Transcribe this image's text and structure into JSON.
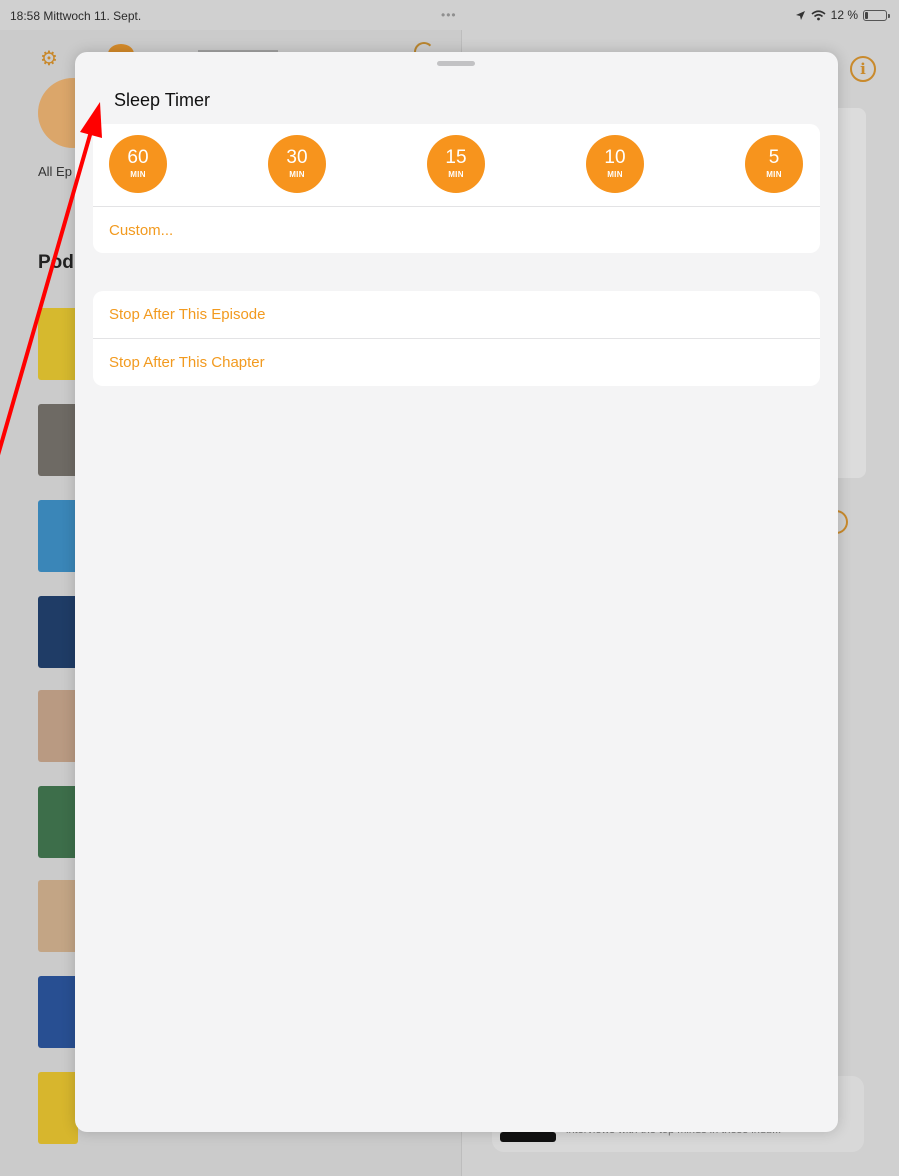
{
  "status_bar": {
    "time_date": "18:58  Mittwoch 11. Sept.",
    "dots": "•••",
    "location_icon": "location-arrow-icon",
    "wifi_icon": "wifi-icon",
    "battery_percent": "12 %",
    "battery_level": 0.12
  },
  "background": {
    "all_episodes_label": "All Ep",
    "podcasts_label": "Pod",
    "mini_player_text": "interviews with the top minds in these indu..."
  },
  "sleep_timer": {
    "title": "Sleep Timer",
    "presets": [
      {
        "value": "60",
        "unit": "MIN"
      },
      {
        "value": "30",
        "unit": "MIN"
      },
      {
        "value": "15",
        "unit": "MIN"
      },
      {
        "value": "10",
        "unit": "MIN"
      },
      {
        "value": "5",
        "unit": "MIN"
      }
    ],
    "custom_label": "Custom...",
    "stop_after_episode": "Stop After This Episode",
    "stop_after_chapter": "Stop After This Chapter"
  },
  "colors": {
    "accent": "#f7941d",
    "accent_text": "#f29a1f",
    "annotation_arrow": "#ff0000"
  }
}
